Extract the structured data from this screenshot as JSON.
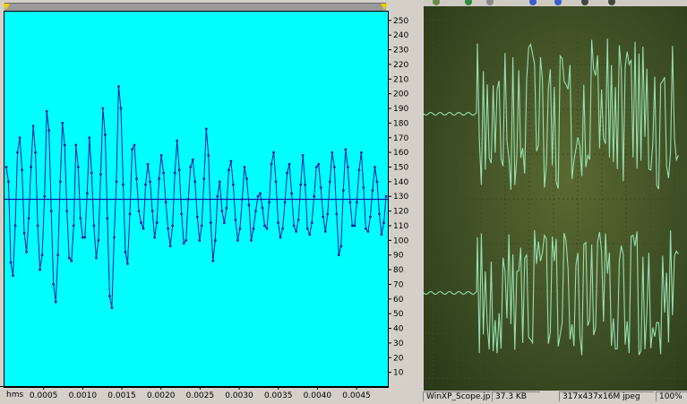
{
  "editor": {
    "x_unit_label": "hms",
    "colors": {
      "plot_bg": "#00ffff",
      "trace": "#1a1aa0",
      "centerline": "#1a1aa0"
    },
    "chart_data": {
      "type": "line",
      "xlabel": "hms",
      "ylabel": "",
      "xlim": [
        0,
        0.0049
      ],
      "ylim": [
        0,
        256
      ],
      "center_value": 128,
      "x_ticks": [
        "0.0005",
        "0.0010",
        "0.0015",
        "0.0020",
        "0.0025",
        "0.0030",
        "0.0035",
        "0.0040",
        "0.0045"
      ],
      "y_ticks": [
        "10",
        "20",
        "30",
        "40",
        "50",
        "60",
        "70",
        "80",
        "90",
        "100",
        "110",
        "120",
        "130",
        "140",
        "150",
        "160",
        "170",
        "180",
        "190",
        "200",
        "210",
        "220",
        "230",
        "240",
        "250"
      ],
      "series": [
        {
          "values": [
            150,
            140,
            85,
            76,
            110,
            160,
            170,
            148,
            105,
            92,
            115,
            150,
            178,
            160,
            110,
            80,
            90,
            130,
            188,
            175,
            120,
            70,
            58,
            90,
            140,
            180,
            165,
            120,
            88,
            86,
            110,
            165,
            150,
            115,
            102,
            102,
            132,
            170,
            146,
            110,
            88,
            100,
            145,
            190,
            172,
            115,
            62,
            54,
            102,
            140,
            205,
            190,
            138,
            92,
            84,
            118,
            162,
            165,
            142,
            120,
            112,
            108,
            138,
            152,
            140,
            120,
            102,
            112,
            142,
            158,
            146,
            126,
            108,
            96,
            110,
            146,
            168,
            148,
            118,
            98,
            100,
            128,
            150,
            155,
            140,
            116,
            100,
            110,
            142,
            176,
            158,
            112,
            86,
            100,
            130,
            140,
            120,
            112,
            122,
            148,
            154,
            138,
            114,
            100,
            108,
            128,
            150,
            142,
            124,
            100,
            108,
            120,
            130,
            132,
            122,
            110,
            108,
            126,
            152,
            160,
            140,
            112,
            102,
            108,
            126,
            146,
            152,
            132,
            110,
            106,
            114,
            138,
            158,
            138,
            108,
            104,
            112,
            130,
            150,
            152,
            136,
            116,
            106,
            118,
            140,
            160,
            150,
            118,
            90,
            96,
            134,
            162,
            150,
            126,
            110,
            110,
            126,
            148,
            160,
            136,
            108,
            106,
            116,
            134,
            150,
            140,
            118,
            104,
            112,
            130
          ]
        }
      ]
    }
  },
  "viewer": {
    "colors": {
      "screen_dark": "#2a3a1a",
      "screen_mid": "#5a6a32",
      "trace": "#a0f0c0",
      "grid": "#3a4a24"
    }
  },
  "statusbar": {
    "filename": "WinXP_Scope.jpg",
    "filesize": "37.3 KB",
    "dimensions": "317x437x16M jpeg",
    "zoom": "100%"
  }
}
